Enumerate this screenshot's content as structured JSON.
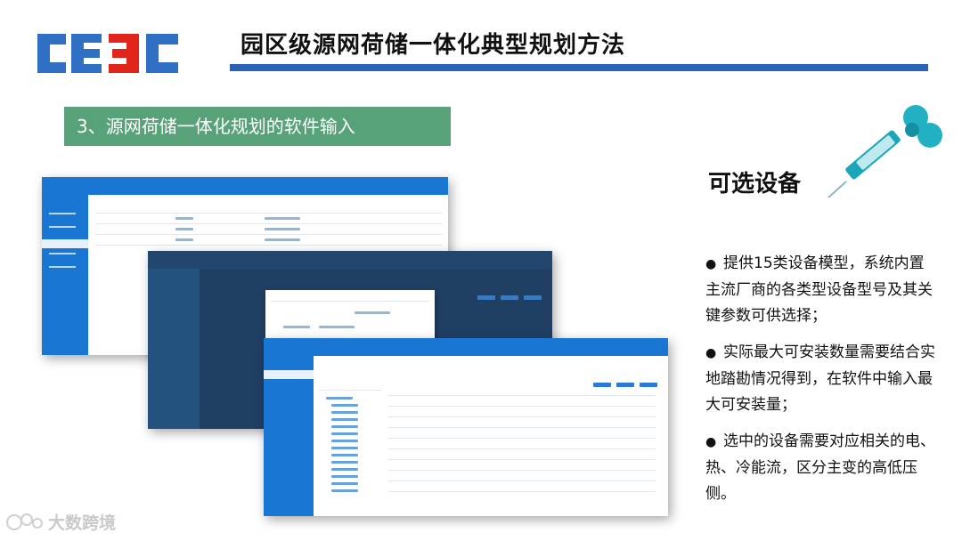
{
  "header": {
    "title": "园区级源网荷储一体化典型规划方法",
    "logo_text": "CEEC"
  },
  "section": {
    "heading": "3、源网荷储一体化规划的软件输入"
  },
  "sidebar_panel": {
    "title": "可选设备",
    "bullets": [
      "提供15类设备模型，系统内置主流厂商的各类型设备型号及其关键参数可供选择；",
      "实际最大可安装数量需要结合实地踏勘情况得到，在软件中输入最大可安装量；",
      "选中的设备需要对应相关的电、热、冷能流，区分主变的高低压侧。"
    ],
    "bullet_symbol": "●"
  },
  "watermark": {
    "text": "大数跨境"
  },
  "colors": {
    "title_bar": "#2a62b5",
    "section_bg": "#58a27a",
    "logo_blue": "#2f6fc4",
    "logo_red": "#e1251b",
    "app_blue": "#1976d2"
  },
  "icons": {
    "decor": "syringe-icon",
    "watermark": "watermark-logo-icon"
  }
}
